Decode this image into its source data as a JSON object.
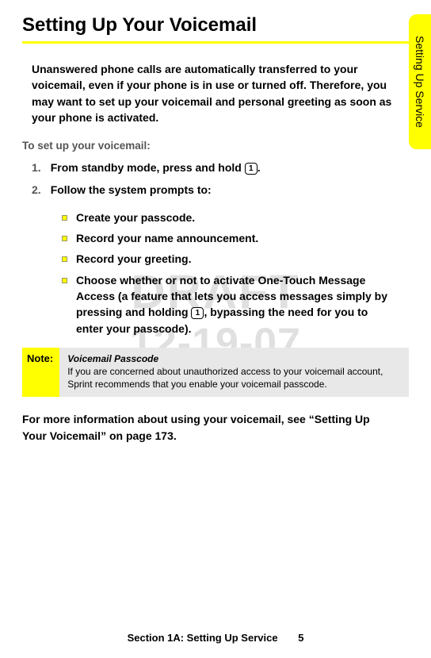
{
  "title": "Setting Up Your Voicemail",
  "side_tab": "Setting Up Service",
  "intro": "Unanswered phone calls are automatically transferred to your voicemail, even if your phone is in use or turned off. Therefore, you may want to set up your voicemail and personal greeting as soon as your phone is activated.",
  "sub_heading": "To set up your voicemail:",
  "steps": [
    {
      "num": "1.",
      "before": "From standby mode, press and hold ",
      "key": "1",
      "after": "."
    },
    {
      "num": "2.",
      "before": "Follow the system prompts to:",
      "key": "",
      "after": ""
    }
  ],
  "bullets": [
    {
      "text": "Create your passcode."
    },
    {
      "text": "Record your name announcement."
    },
    {
      "text": "Record your greeting."
    },
    {
      "before": "Choose whether or not to activate One-Touch Message Access (a feature that lets you access messages simply by pressing and holding ",
      "key": "1",
      "after": ", bypassing the need for you to enter your passcode)."
    }
  ],
  "note": {
    "label": "Note:",
    "title": "Voicemail Passcode",
    "body": "If you are concerned about unauthorized access to your voicemail account, Sprint recommends that you enable your voicemail passcode."
  },
  "closing": "For more information about using your voicemail, see “Setting Up Your Voicemail” on page 173.",
  "watermark": {
    "line1": "DRAFT",
    "line2": "12-19-07"
  },
  "footer": {
    "section": "Section 1A: Setting Up Service",
    "page": "5"
  }
}
